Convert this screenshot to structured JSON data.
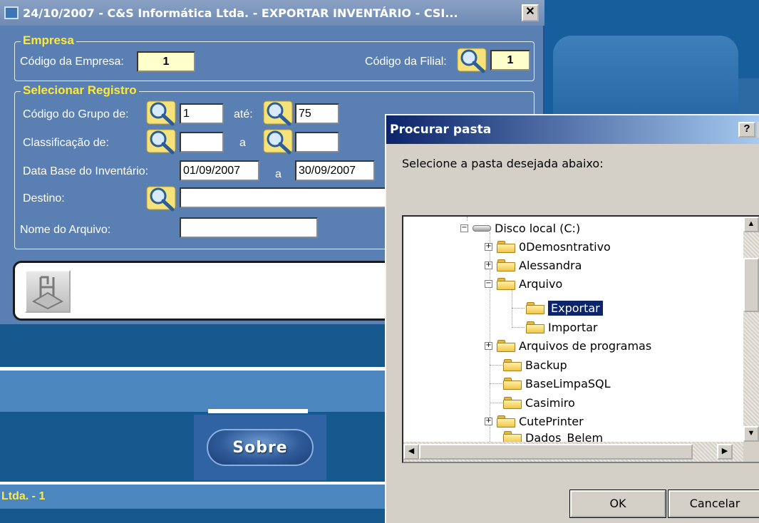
{
  "window": {
    "title": "24/10/2007  -  C&S Informática Ltda.  -  EXPORTAR INVENTÁRIO  -  CSI..."
  },
  "empresa": {
    "legend": "Empresa",
    "codigo_empresa_label": "Código da Empresa:",
    "codigo_empresa_value": "1",
    "codigo_filial_label": "Código da Filial:",
    "codigo_filial_value": "1"
  },
  "selecionar": {
    "legend": "Selecionar Registro",
    "grupo_label": "Código do Grupo de:",
    "grupo_de": "1",
    "grupo_ate_label": "até:",
    "grupo_ate": "75",
    "classificacao_label": "Classificação de:",
    "classificacao_de": "",
    "classificacao_a_label": "a",
    "classificacao_a": "",
    "data_base_label": "Data Base do Inventário:",
    "data_de": "01/09/2007",
    "data_a_label": "a",
    "data_a": "30/09/2007",
    "destino_label": "Destino:",
    "destino_value": "",
    "nome_arquivo_label": "Nome do Arquivo:",
    "nome_arquivo_value": ""
  },
  "background": {
    "sobre_label": "Sobre",
    "status_text": "Ltda. - 1"
  },
  "dialog": {
    "title": "Procurar pasta",
    "help_label": "?",
    "message": "Selecione a pasta desejada abaixo:",
    "tree": [
      {
        "label": "Disco local (C:)",
        "type": "drive",
        "expander": "-",
        "level": 0,
        "selected": false
      },
      {
        "label": "0Demosntrativo",
        "type": "folder",
        "expander": "+",
        "level": 1,
        "selected": false
      },
      {
        "label": "Alessandra",
        "type": "folder",
        "expander": "+",
        "level": 1,
        "selected": false
      },
      {
        "label": "Arquivo",
        "type": "folder",
        "expander": "-",
        "level": 1,
        "selected": false
      },
      {
        "label": "Exportar",
        "type": "folder",
        "expander": "",
        "level": 2,
        "selected": true
      },
      {
        "label": "Importar",
        "type": "folder",
        "expander": "",
        "level": 2,
        "selected": false
      },
      {
        "label": "Arquivos de programas",
        "type": "folder",
        "expander": "+",
        "level": 1,
        "selected": false
      },
      {
        "label": "Backup",
        "type": "folder",
        "expander": "",
        "level": 1,
        "selected": false
      },
      {
        "label": "BaseLimpaSQL",
        "type": "folder",
        "expander": "",
        "level": 1,
        "selected": false
      },
      {
        "label": "Casimiro",
        "type": "folder",
        "expander": "",
        "level": 1,
        "selected": false
      },
      {
        "label": "CutePrinter",
        "type": "folder",
        "expander": "+",
        "level": 1,
        "selected": false
      },
      {
        "label": "Dados_Belem",
        "type": "folder",
        "expander": "",
        "level": 1,
        "selected": false
      }
    ],
    "ok_label": "OK",
    "cancel_label": "Cancelar"
  }
}
